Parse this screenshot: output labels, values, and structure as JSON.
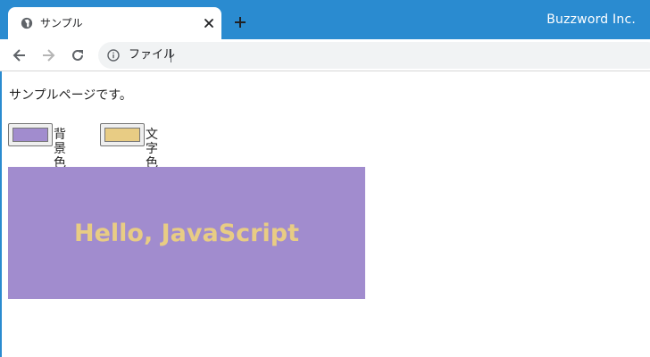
{
  "browser": {
    "tab_title": "サンプル",
    "brand": "Buzzword Inc.",
    "address_text": "ファイル",
    "icons": {
      "favicon": "globe-icon",
      "close": "close-icon",
      "new_tab": "plus-icon",
      "back": "back-arrow-icon",
      "forward": "forward-arrow-icon",
      "reload": "reload-icon",
      "site_info": "info-icon"
    },
    "colors": {
      "tabstrip": "#2a8bd0"
    }
  },
  "page": {
    "intro": "サンプルページです。",
    "background_picker": {
      "label": "背景色",
      "value": "#a18cce"
    },
    "text_picker": {
      "label": "文字色",
      "value": "#e8cc84"
    },
    "panel": {
      "text": "Hello, JavaScript"
    }
  }
}
